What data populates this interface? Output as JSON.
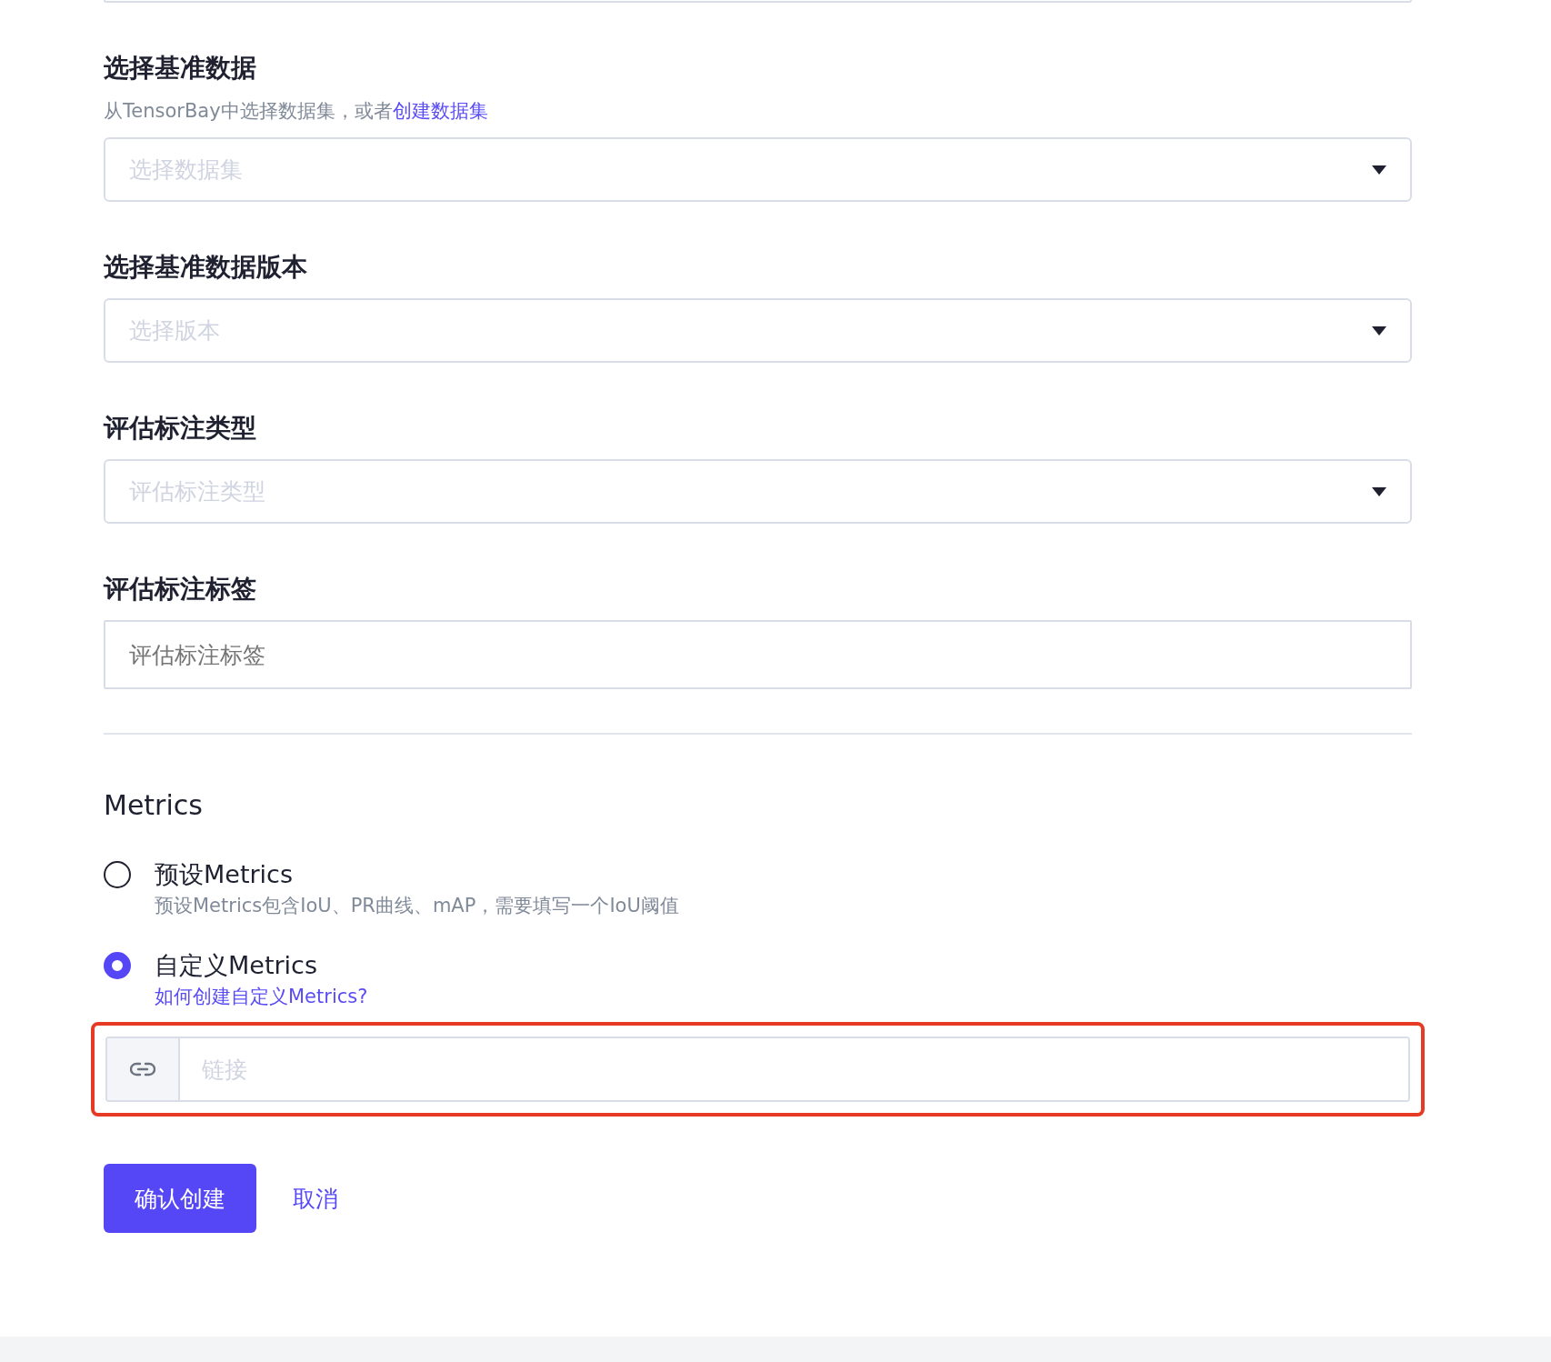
{
  "sections": [
    {
      "kind": "select",
      "label": "选择基准数据",
      "hint": "从TensorBay中选择数据集，或者",
      "hint_link": "创建数据集",
      "placeholder": "选择数据集"
    },
    {
      "kind": "select",
      "label": "选择基准数据版本",
      "placeholder": "选择版本"
    },
    {
      "kind": "select",
      "label": "评估标注类型",
      "placeholder": "评估标注类型"
    },
    {
      "kind": "input",
      "label": "评估标注标签",
      "placeholder": "评估标注标签"
    }
  ],
  "metrics": {
    "title": "Metrics",
    "options": [
      {
        "label": "预设Metrics",
        "selected": false,
        "description": "预设Metrics包含IoU、PR曲线、mAP，需要填写一个IoU阈值"
      },
      {
        "label": "自定义Metrics",
        "selected": true,
        "link": "如何创建自定义Metrics?"
      }
    ],
    "link_field": {
      "placeholder": "链接",
      "highlighted": true
    }
  },
  "buttons": {
    "confirm": "确认创建",
    "cancel": "取消"
  }
}
